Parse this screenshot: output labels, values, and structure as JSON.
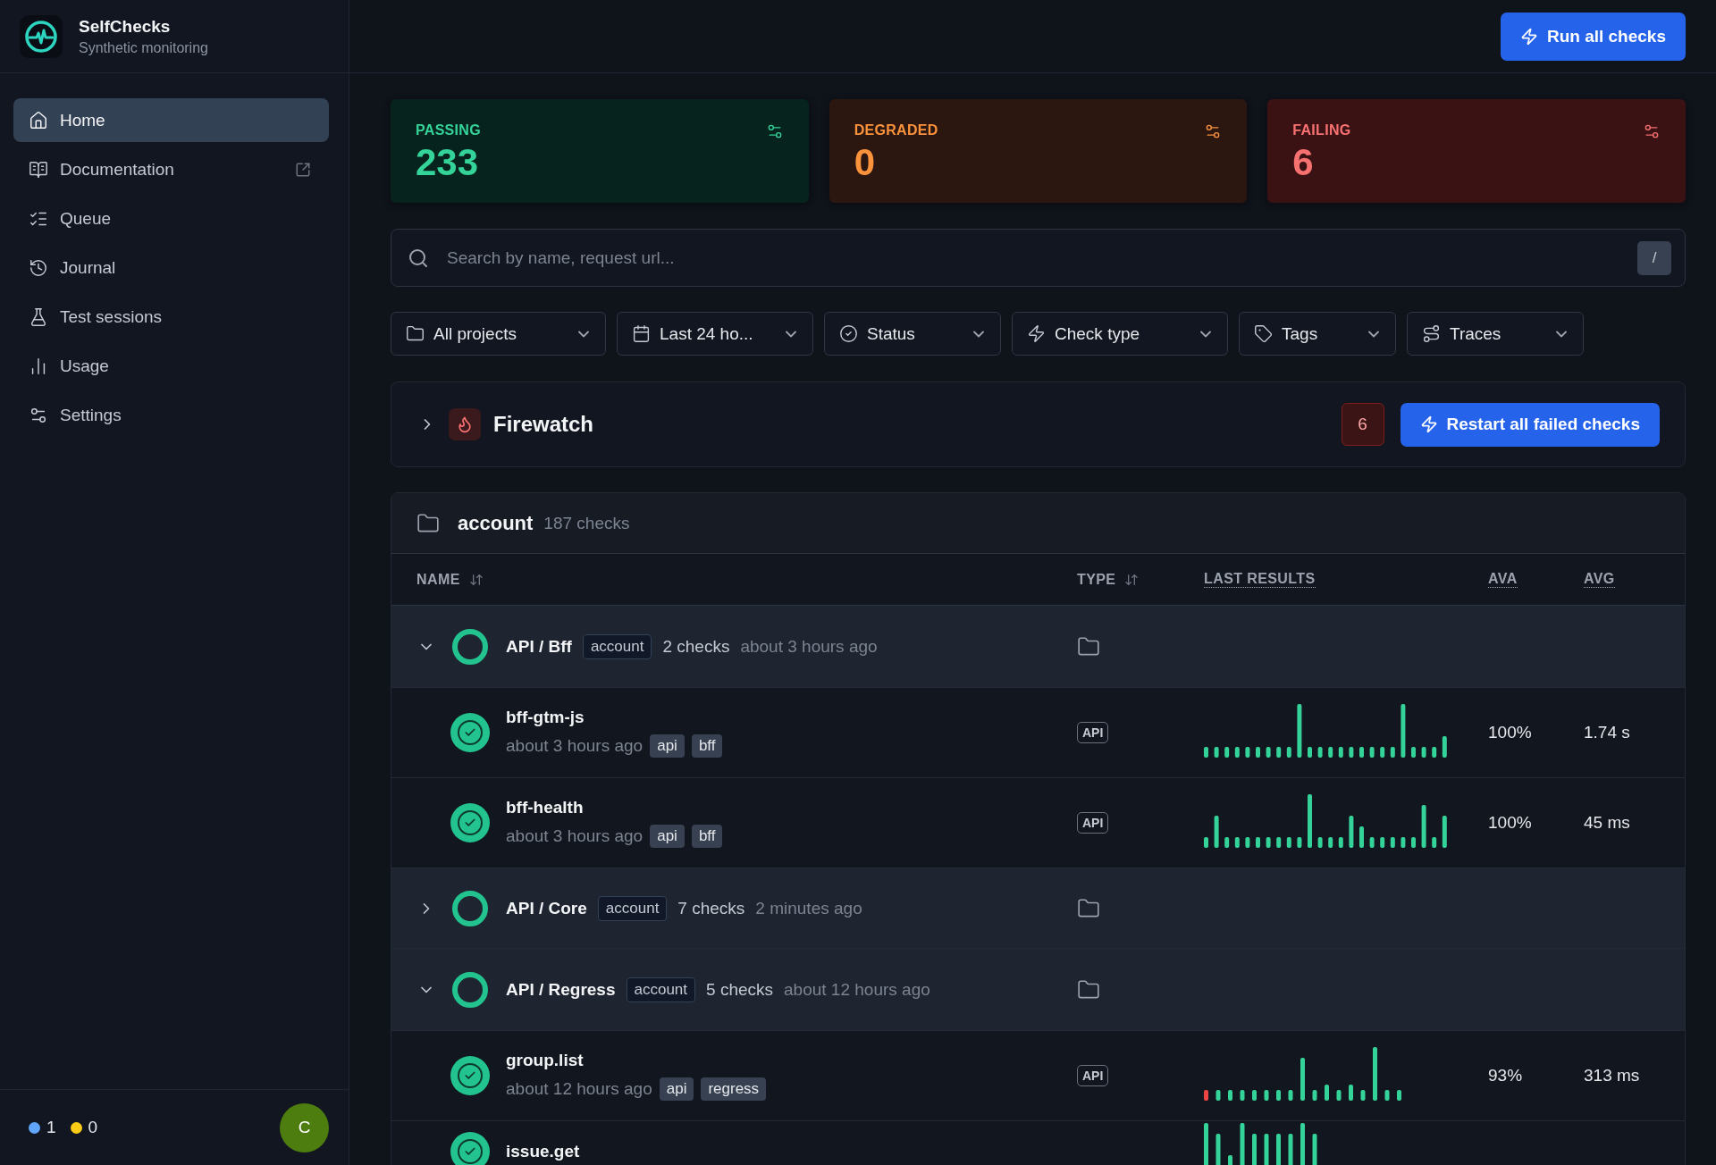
{
  "app": {
    "name": "SelfChecks",
    "subtitle": "Synthetic monitoring"
  },
  "sidebar": {
    "items": [
      {
        "label": "Home",
        "selected": true,
        "external": false
      },
      {
        "label": "Documentation",
        "selected": false,
        "external": true
      },
      {
        "label": "Queue",
        "selected": false,
        "external": false
      },
      {
        "label": "Journal",
        "selected": false,
        "external": false
      },
      {
        "label": "Test sessions",
        "selected": false,
        "external": false
      },
      {
        "label": "Usage",
        "selected": false,
        "external": false
      },
      {
        "label": "Settings",
        "selected": false,
        "external": false
      }
    ],
    "counters": [
      {
        "count": "1",
        "color": "#60a5fa"
      },
      {
        "count": "0",
        "color": "#facc15"
      }
    ],
    "avatar": "C"
  },
  "header": {
    "button": "Run all checks"
  },
  "stats": [
    {
      "kind": "passing",
      "label": "PASSING",
      "value": "233"
    },
    {
      "kind": "degraded",
      "label": "DEGRADED",
      "value": "0"
    },
    {
      "kind": "failing",
      "label": "FAILING",
      "value": "6"
    }
  ],
  "search": {
    "placeholder": "Search by name, request url...",
    "shortcut": "/"
  },
  "filters": [
    "All projects",
    "Last 24 ho...",
    "Status",
    "Check type",
    "Tags",
    "Traces"
  ],
  "alert": {
    "title": "Firewatch",
    "expanded": false,
    "count": "6",
    "button": "Restart all failed checks"
  },
  "table": {
    "folder": "account",
    "count": "187 checks",
    "columns": [
      {
        "label": "NAME",
        "sortable": true
      },
      {
        "label": "TYPE",
        "sortable": true
      },
      {
        "label": "LAST RESULTS",
        "sortable": false
      },
      {
        "label": "AVA",
        "sortable": false
      },
      {
        "label": "AVG",
        "sortable": false
      }
    ],
    "rows": [
      {
        "name": "API / Bff",
        "tag": "account",
        "count": "2 checks",
        "time": "about 3 hours ago",
        "expanded": true,
        "children": [
          {
            "name": "bff-gtm-js",
            "time": "about 3 hours ago",
            "tags": [
              "api",
              "bff"
            ],
            "type": "API",
            "ava": "100%",
            "avg": "1.74 s"
          },
          {
            "name": "bff-health",
            "time": "about 3 hours ago",
            "tags": [
              "api",
              "bff"
            ],
            "type": "API",
            "ava": "100%",
            "avg": "45 ms"
          }
        ]
      },
      {
        "name": "API / Core",
        "tag": "account",
        "count": "7 checks",
        "time": "2 minutes ago",
        "expanded": false,
        "children": []
      },
      {
        "name": "API / Regress",
        "tag": "account",
        "count": "5 checks",
        "time": "about 12 hours ago",
        "expanded": true,
        "children": [
          {
            "name": "group.list",
            "time": "about 12 hours ago",
            "tags": [
              "api",
              "regress"
            ],
            "type": "API",
            "ava": "93%",
            "avg": "313 ms"
          },
          {
            "name": "issue.get"
          }
        ]
      }
    ]
  }
}
